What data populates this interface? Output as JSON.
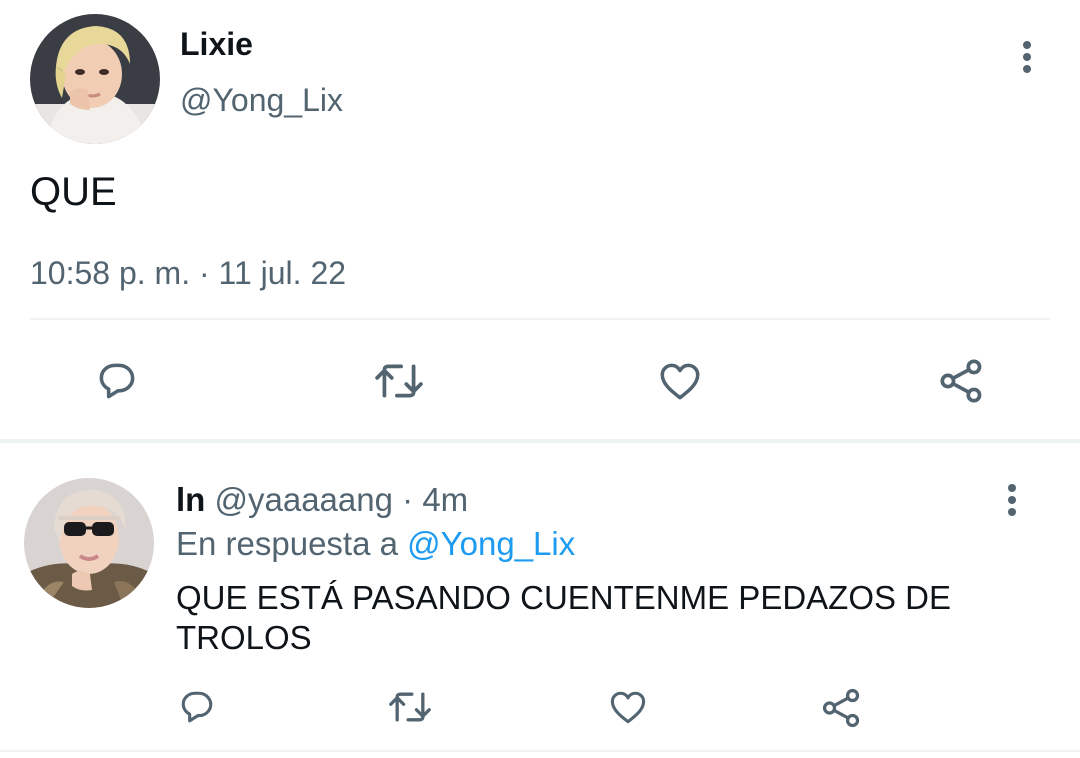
{
  "main_tweet": {
    "display_name": "Lixie",
    "handle": "@Yong_Lix",
    "text": "QUE",
    "time": "10:58 p. m.",
    "separator": "·",
    "date": "11 jul. 22"
  },
  "reply": {
    "display_name": "ln",
    "handle": "@yaaaaang",
    "separator": "·",
    "time": "4m",
    "in_reply_prefix": "En respuesta a",
    "in_reply_mention": "@Yong_Lix",
    "text": "QUE ESTÁ PASANDO CUENTENME PEDAZOS DE TROLOS"
  },
  "icons": {
    "more": "more-vertical-icon",
    "reply": "comment-icon",
    "retweet": "retweet-icon",
    "like": "heart-icon",
    "share": "share-icon"
  },
  "colors": {
    "text_primary": "#0f1419",
    "text_secondary": "#536471",
    "link": "#1d9bf0",
    "divider": "#eff3f4"
  }
}
